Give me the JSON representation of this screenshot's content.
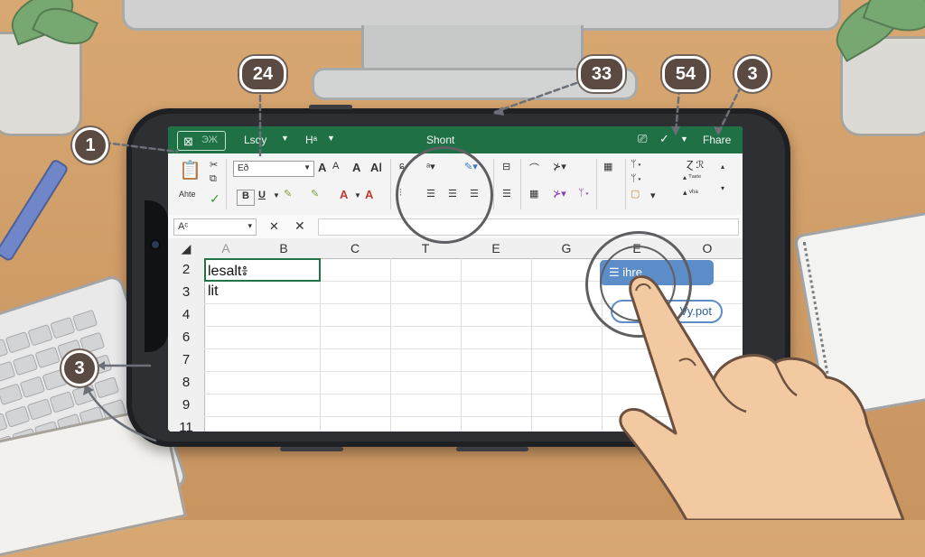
{
  "window": {
    "save_label": "⊠",
    "save_value": "ЭЖ",
    "ready_label": "Lsdy",
    "page_label": "Hᵃ",
    "title": "Shont",
    "share_label": "Fhare"
  },
  "ribbon": {
    "paste_label": "Ahte",
    "font_name": "Eð",
    "bold": "B",
    "underline": "U",
    "font_grow": "A",
    "font_shrink": "A"
  },
  "formula_bar": {
    "name_box": "Aᶜ",
    "cancel": "✕",
    "fx_value": ""
  },
  "grid": {
    "columns": [
      "A",
      "B",
      "C",
      "T",
      "E",
      "G",
      "E",
      "O"
    ],
    "rows": [
      "2",
      "3",
      "4",
      "6",
      "7",
      "8",
      "9",
      "11"
    ],
    "cell_b2": "lesalt៖",
    "cell_b3": "lit",
    "chip_primary": "☰ ihre",
    "chip_secondary": "Vy.pot"
  },
  "callouts": [
    "1",
    "24",
    "33",
    "54",
    "3",
    "3"
  ],
  "colors": {
    "excel_green": "#1f7145",
    "chip_blue": "#5c8dc9",
    "callout": "#5a4a42",
    "desk": "#d2a06b"
  }
}
